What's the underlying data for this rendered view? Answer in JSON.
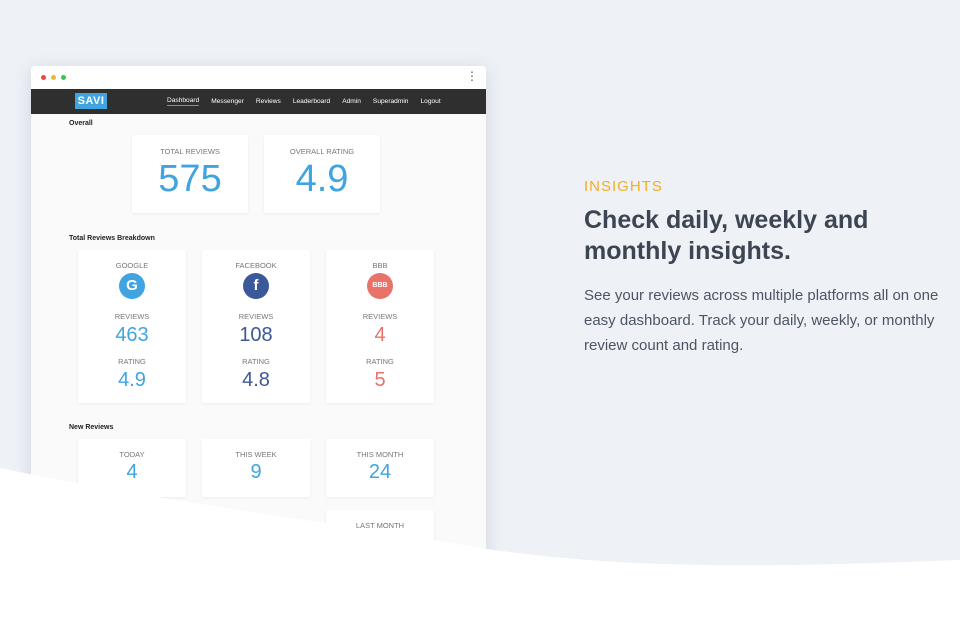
{
  "nav": {
    "logo": "SAVI",
    "links": [
      "Dashboard",
      "Messenger",
      "Reviews",
      "Leaderboard",
      "Admin",
      "Superadmin",
      "Logout"
    ],
    "active": "Dashboard"
  },
  "overall": {
    "section_title": "Overall",
    "total_reviews_label": "TOTAL REVIEWS",
    "total_reviews_value": "575",
    "overall_rating_label": "OVERALL RATING",
    "overall_rating_value": "4.9"
  },
  "breakdown": {
    "section_title": "Total Reviews Breakdown",
    "platforms": [
      {
        "name": "GOOGLE",
        "icon": "google-icon",
        "icon_glyph": "G",
        "reviews_label": "REVIEWS",
        "reviews": "463",
        "rating_label": "RATING",
        "rating": "4.9",
        "color": "#3fa4e0"
      },
      {
        "name": "FACEBOOK",
        "icon": "facebook-icon",
        "icon_glyph": "f",
        "reviews_label": "REVIEWS",
        "reviews": "108",
        "rating_label": "RATING",
        "rating": "4.8",
        "color": "#3b5998"
      },
      {
        "name": "BBB",
        "icon": "bbb-icon",
        "icon_glyph": "BBB",
        "reviews_label": "REVIEWS",
        "reviews": "4",
        "rating_label": "RATING",
        "rating": "5",
        "color": "#e8736a"
      }
    ]
  },
  "new_reviews": {
    "section_title": "New Reviews",
    "today_label": "TODAY",
    "today_value": "4",
    "week_label": "THIS WEEK",
    "week_value": "9",
    "month_label": "THIS MONTH",
    "month_value": "24",
    "last_month_label": "LAST MONTH"
  },
  "marketing": {
    "eyebrow": "INSIGHTS",
    "headline": "Check daily, weekly and monthly insights.",
    "body": "See your reviews across multiple platforms all on one easy dashboard.  Track your daily, weekly, or monthly review count and rating."
  },
  "colors": {
    "accent_blue": "#3fa4e0",
    "facebook_navy": "#3b5998",
    "bbb_coral": "#e8736a",
    "eyebrow_orange": "#f0ad28",
    "page_bg": "#eef2f7"
  }
}
